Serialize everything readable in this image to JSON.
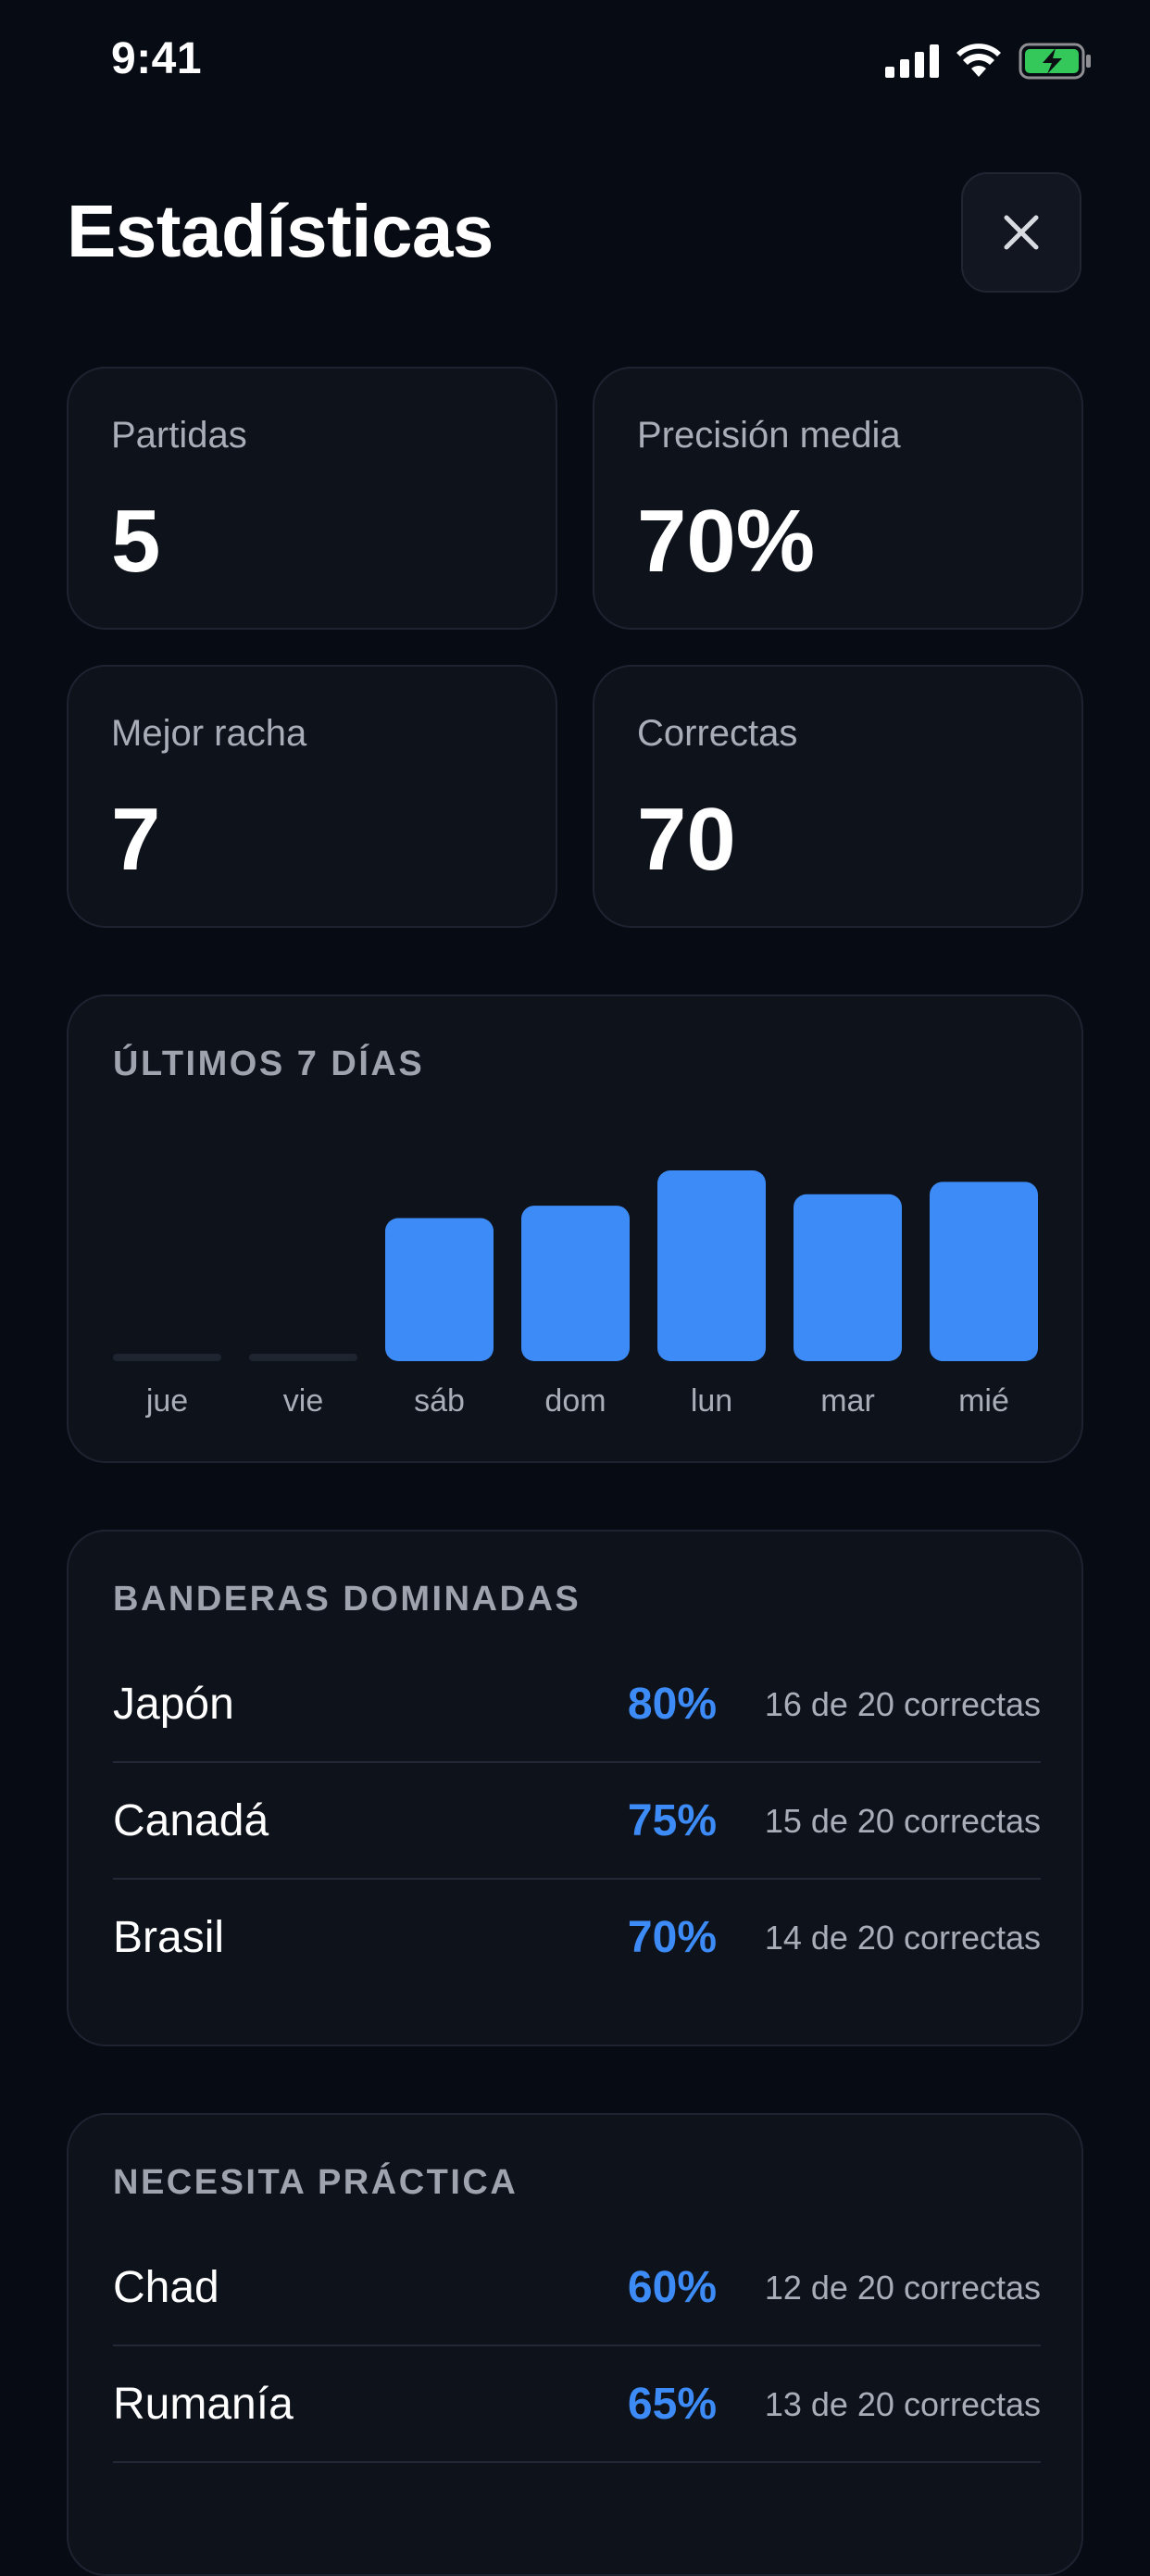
{
  "status_bar": {
    "time": "9:41",
    "icons": [
      "signal-icon",
      "wifi-icon",
      "battery-charging-icon"
    ],
    "battery_color": "#34C759"
  },
  "header": {
    "title": "Estadísticas",
    "close_icon": "close-icon"
  },
  "stats": [
    {
      "label": "Partidas",
      "value": "5"
    },
    {
      "label": "Precisión media",
      "value": "70%"
    },
    {
      "label": "Mejor racha",
      "value": "7"
    },
    {
      "label": "Correctas",
      "value": "70"
    }
  ],
  "weekly": {
    "title": "ÚLTIMOS 7 DÍAS",
    "chart_data": {
      "type": "bar",
      "categories": [
        "jue",
        "vie",
        "sáb",
        "dom",
        "lun",
        "mar",
        "mié"
      ],
      "values": [
        0,
        0,
        15,
        16.3,
        20,
        17.5,
        18.8
      ],
      "ylim": [
        0,
        20
      ],
      "bar_color": "#3D8BF7",
      "empty_color": "#1E2430",
      "grid": false,
      "legend": "none"
    }
  },
  "mastered": {
    "title": "BANDERAS DOMINADAS",
    "rows": [
      {
        "name": "Japón",
        "pct": "80%",
        "detail": "16 de 20 correctas"
      },
      {
        "name": "Canadá",
        "pct": "75%",
        "detail": "15 de 20 correctas"
      },
      {
        "name": "Brasil",
        "pct": "70%",
        "detail": "14 de 20 correctas"
      }
    ]
  },
  "practice": {
    "title": "NECESITA PRÁCTICA",
    "rows": [
      {
        "name": "Chad",
        "pct": "60%",
        "detail": "12 de 20 correctas"
      },
      {
        "name": "Rumanía",
        "pct": "65%",
        "detail": "13 de 20 correctas"
      }
    ]
  },
  "colors": {
    "background": "#070B14",
    "card": "#0E121B",
    "accent": "#3D8BF7",
    "muted_text": "#A8ADB7"
  }
}
